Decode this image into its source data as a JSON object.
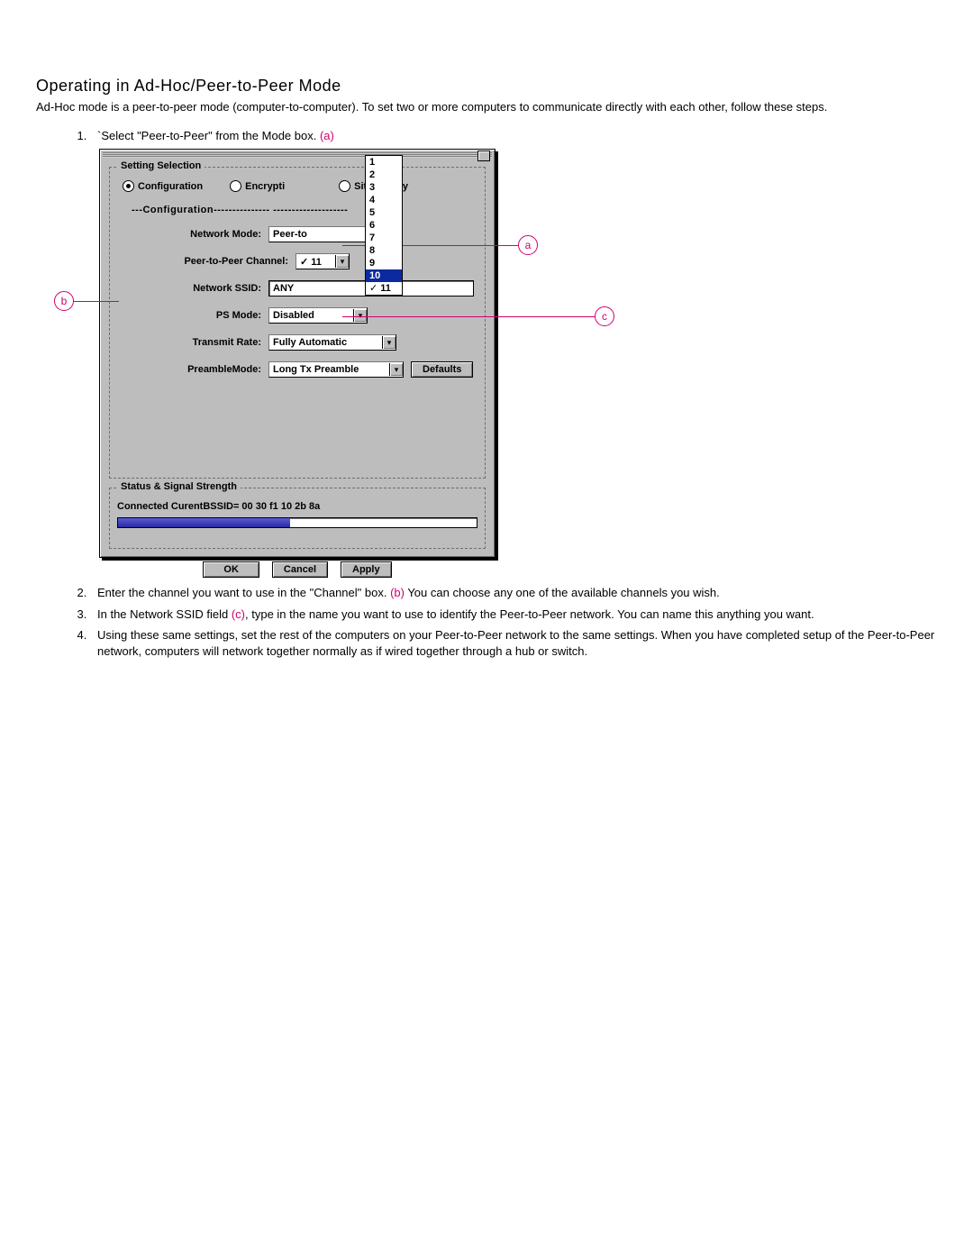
{
  "doc": {
    "title": "Operating in Ad-Hoc/Peer-to-Peer Mode",
    "intro": "Ad-Hoc mode is a peer-to-peer mode (computer-to-computer). To set two or more computers to communicate directly with each other, follow these steps.",
    "steps": {
      "s1_pre": "`Select \"Peer-to-Peer\" from the Mode box. ",
      "s1_ref": "(a)",
      "s2_pre": "Enter the channel you want to use in the \"Channel\" box. ",
      "s2_ref": "(b)",
      "s2_post": " You can choose any one of the available channels you wish.",
      "s3_pre": "In the Network SSID field ",
      "s3_ref": "(c)",
      "s3_post": ", type in the name you want to use to identify the Peer-to-Peer network. You can name this anything you want.",
      "s4": "Using these same settings, set the rest of the computers on your Peer-to-Peer network to the same settings. When you have completed setup of the Peer-to-Peer network, computers will network together normally as if wired together through a hub or switch."
    }
  },
  "callouts": {
    "a": "a",
    "b": "b",
    "c": "c"
  },
  "dialog": {
    "group_setting": "Setting Selection",
    "radio_config": "Configuration",
    "radio_encrypt": "Encrypti",
    "radio_site": "Site Survey",
    "config_sep": "---Configuration---------------             --------------------",
    "labels": {
      "network_mode": "Network Mode:",
      "p2p_channel": "Peer-to-Peer Channel:",
      "ssid": "Network SSID:",
      "ps_mode": "PS Mode:",
      "tx_rate": "Transmit Rate:",
      "preamble": "PreambleMode:"
    },
    "values": {
      "network_mode": "Peer-to",
      "p2p_channel": "11",
      "ssid": "ANY",
      "ps_mode": "Disabled",
      "tx_rate": "Fully Automatic",
      "preamble": "Long Tx Preamble"
    },
    "defaults_btn": "Defaults",
    "dropdown_options": [
      "1",
      "2",
      "3",
      "4",
      "5",
      "6",
      "7",
      "8",
      "9",
      "10",
      "11"
    ],
    "dropdown_selected": "10",
    "dropdown_checked": "11",
    "group_status": "Status & Signal Strength",
    "status_text": "Connected  CurentBSSID= 00 30 f1 10 2b 8a",
    "signal_percent": 48,
    "buttons": {
      "ok": "OK",
      "cancel": "Cancel",
      "apply": "Apply"
    }
  }
}
